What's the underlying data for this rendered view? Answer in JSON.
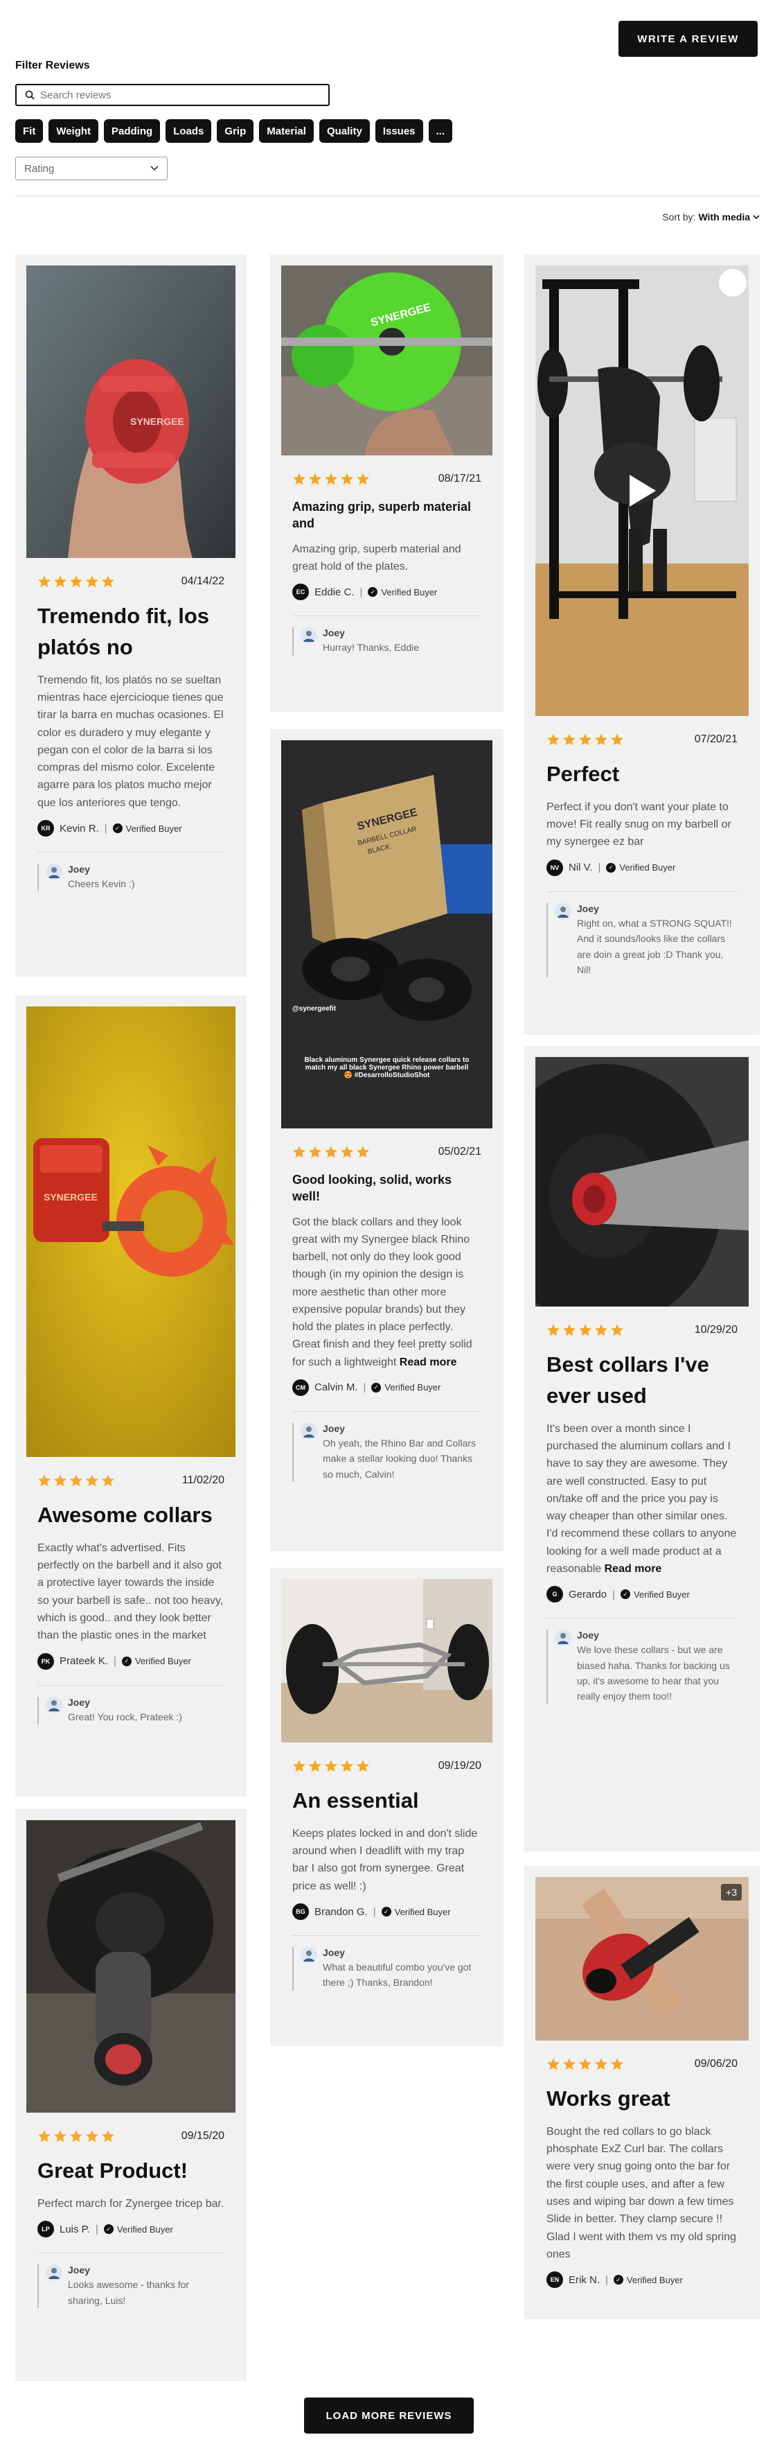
{
  "header": {
    "write_review": "WRITE A REVIEW"
  },
  "filters": {
    "title": "Filter Reviews",
    "search_placeholder": "Search reviews",
    "chips": [
      "Fit",
      "Weight",
      "Padding",
      "Loads",
      "Grip",
      "Material",
      "Quality",
      "Issues",
      "..."
    ],
    "rating_label": "Rating"
  },
  "sort": {
    "label": "Sort by:",
    "value": "With media"
  },
  "verified_label": "Verified Buyer",
  "star_color": "#f5a623",
  "reviews": [
    {
      "date": "04/14/22",
      "title": "Tremendo fit, los platós no",
      "text": "Tremendo fit, los platós no se sueltan mientras hace ejercicioque tienes que tirar la barra en muchas ocasiones. El color es duradero y muy elegante y pegan con el color de la barra si los compras del mismo color. Excelente agarre para los platos mucho mejor que los anteriores que tengo.",
      "initials": "KR",
      "author": "Kevin R.",
      "reply_name": "Joey",
      "reply": "Cheers Kevin :)"
    },
    {
      "date": "08/17/21",
      "title": "Amazing grip, superb material and",
      "text": "Amazing grip, superb material and great hold of the plates.",
      "initials": "EC",
      "author": "Eddie C.",
      "reply_name": "Joey",
      "reply": "Hurray! Thanks, Eddie"
    },
    {
      "date": "07/20/21",
      "title": "Perfect",
      "text": "Perfect if you don't want your plate to move! Fit really snug on my barbell or my synergee ez bar",
      "initials": "NV",
      "author": "Nil V.",
      "reply_name": "Joey",
      "reply": "Right on, what a STRONG SQUAT!! And it sounds/looks like the collars are doin a great job :D Thank you, Nil!"
    },
    {
      "date": "05/02/21",
      "title": "Good looking, solid, works well!",
      "text": "Got the black collars and they look great with my Synergee black Rhino barbell, not only do they look good though (in my opinion the design is more aesthetic than other more expensive popular brands) but they hold the plates in place perfectly. Great finish and they feel pretty solid for such a lightweight",
      "more": "Read more",
      "initials": "CM",
      "author": "Calvin M.",
      "reply_name": "Joey",
      "reply": "Oh yeah, the Rhino Bar and Collars make a stellar looking duo! Thanks so much, Calvin!",
      "photo_caption": "@synergeefit",
      "photo_caption2": "Black aluminum Synergee quick release collars to match my all black Synergee Rhino power barbell 😍 #DesarrolloStudioShot",
      "box_brand": "SYNERGEE",
      "box_line1": "BARBELL COLLAR",
      "box_line2": "BLACK"
    },
    {
      "date": "11/02/20",
      "title": "Awesome collars",
      "text": "Exactly what's advertised. Fits perfectly on the barbell and it also got a protective layer towards the inside so your barbell is safe.. not too heavy, which is good.. and they look better than the plastic ones in the market",
      "initials": "PK",
      "author": "Prateek K.",
      "reply_name": "Joey",
      "reply": "Great! You rock, Prateek :)"
    },
    {
      "date": "10/29/20",
      "title": "Best collars I've ever used",
      "text": "It's been over a month since I purchased the aluminum collars and I have to say they are awesome. They are well constructed. Easy to put on/take off and the price you pay is way cheaper than other similar ones. I'd recommend these collars to anyone looking for a well made product at a reasonable",
      "more": "Read more",
      "initials": "G",
      "author": "Gerardo",
      "reply_name": "Joey",
      "reply": "We love these collars - but we are biased haha. Thanks for backing us up, it's awesome to hear that you really enjoy them too!!"
    },
    {
      "date": "09/19/20",
      "title": "An essential",
      "text": "Keeps plates locked in and don't slide around when I deadlift with my trap bar I also got from synergee. Great price as well! :)",
      "initials": "BG",
      "author": "Brandon G.",
      "reply_name": "Joey",
      "reply": "What a beautiful combo you've got there ;) Thanks, Brandon!"
    },
    {
      "date": "09/15/20",
      "title": "Great Product!",
      "text": "Perfect march for Zynergee tricep bar.",
      "initials": "LP",
      "author": "Luis P.",
      "reply_name": "Joey",
      "reply": "Looks awesome - thanks for sharing, Luis!"
    },
    {
      "date": "09/06/20",
      "title": "Works great",
      "text": "Bought the red collars to go black phosphate ExZ Curl bar. The collars were very snug going onto the bar for the first couple uses, and after a few uses and wiping bar down a few times Slide in better. They clamp secure !! Glad I went with them vs my old spring ones",
      "initials": "EN",
      "author": "Erik N.",
      "photo_badge": "+3"
    }
  ],
  "footer": {
    "load_more": "LOAD MORE REVIEWS"
  }
}
